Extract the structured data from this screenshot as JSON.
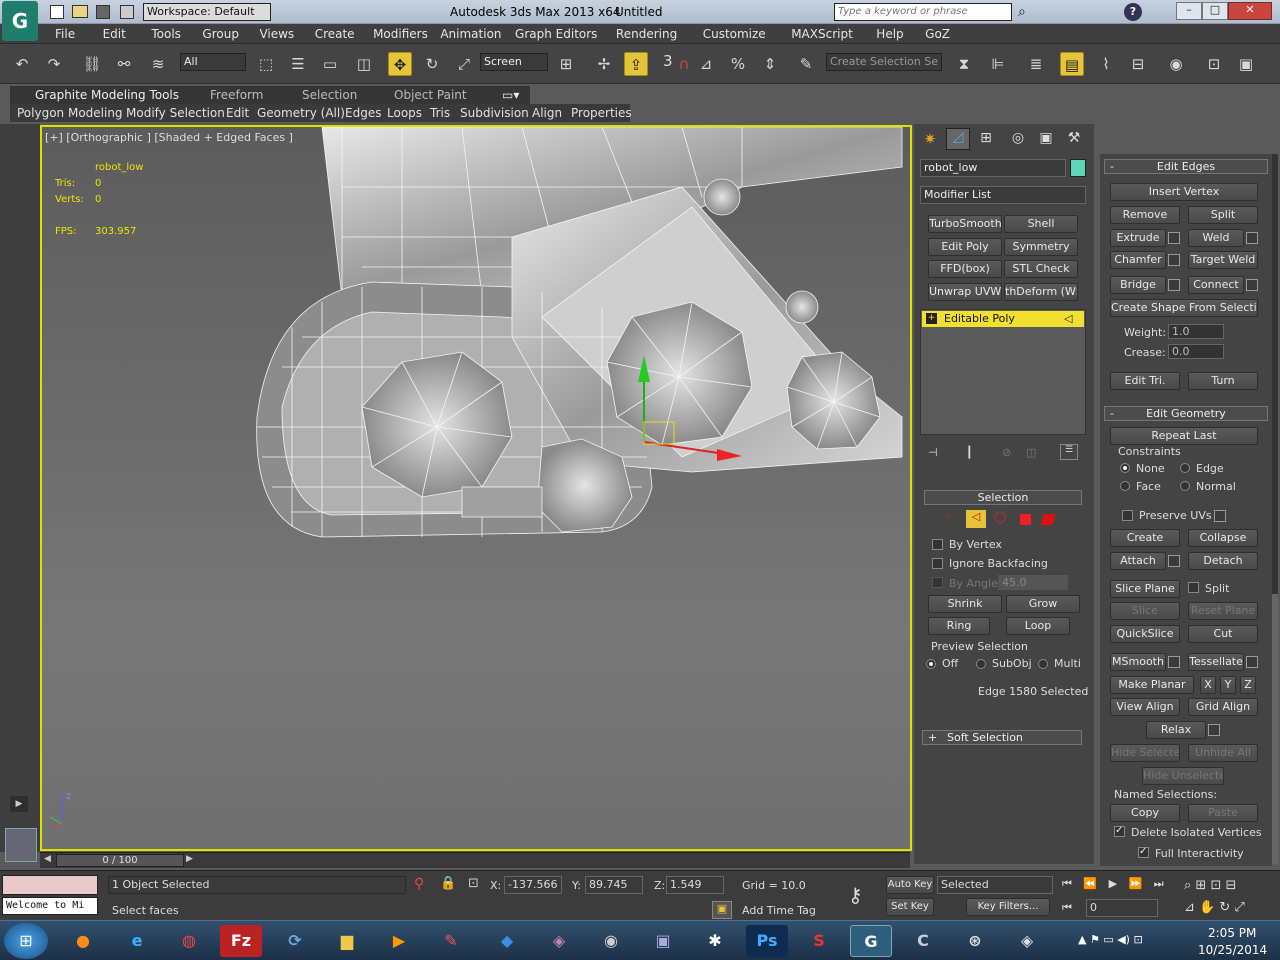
{
  "window": {
    "title": "Autodesk 3ds Max 2013 x64",
    "doc": "Untitled",
    "workspace": "Workspace: Default",
    "search_placeholder": "Type a keyword or phrase"
  },
  "menu": [
    "File",
    "Edit",
    "Tools",
    "Group",
    "Views",
    "Create",
    "Modifiers",
    "Animation",
    "Graph Editors",
    "Rendering",
    "Customize",
    "MAXScript",
    "Help",
    "GoZ"
  ],
  "toolbar": {
    "filter": "All",
    "coord": "Screen",
    "selset_placeholder": "Create Selection Se",
    "number": "3"
  },
  "ribbon": {
    "tabs": [
      "Graphite Modeling Tools",
      "Freeform",
      "Selection",
      "Object Paint"
    ],
    "panels": [
      "Polygon Modeling",
      "Modify Selection",
      "Edit",
      "Geometry (All)",
      "Edges",
      "Loops",
      "Tris",
      "Subdivision",
      "Align",
      "Properties"
    ]
  },
  "viewport": {
    "label": "[+] [Orthographic ] [Shaded + Edged Faces ]",
    "object": "robot_low",
    "tris_label": "Tris:",
    "tris": "0",
    "verts_label": "Verts:",
    "verts": "0",
    "fps_label": "FPS:",
    "fps": "303.957"
  },
  "modify": {
    "name": "robot_low",
    "modlist": "Modifier List",
    "mods": [
      "TurboSmooth",
      "Shell",
      "Edit Poly",
      "Symmetry",
      "FFD(box)",
      "STL Check",
      "Unwrap UVW",
      "thDeform (WSI"
    ],
    "stack_item": "Editable Poly"
  },
  "selection": {
    "title": "Selection",
    "by_vertex": "By Vertex",
    "ignore_backfacing": "Ignore Backfacing",
    "by_angle": "By Angle:",
    "angle": "45.0",
    "shrink": "Shrink",
    "grow": "Grow",
    "ring": "Ring",
    "loop": "Loop",
    "preview": "Preview Selection",
    "off": "Off",
    "subobj": "SubObj",
    "multi": "Multi",
    "status": "Edge 1580 Selected",
    "soft": "Soft Selection"
  },
  "edit_edges": {
    "title": "Edit Edges",
    "insert_vertex": "Insert Vertex",
    "remove": "Remove",
    "split": "Split",
    "extrude": "Extrude",
    "weld": "Weld",
    "chamfer": "Chamfer",
    "target_weld": "Target Weld",
    "bridge": "Bridge",
    "connect": "Connect",
    "create_shape": "Create Shape From Selection",
    "weight_label": "Weight:",
    "weight": "1.0",
    "crease_label": "Crease:",
    "crease": "0.0",
    "edit_tri": "Edit Tri.",
    "turn": "Turn"
  },
  "edit_geometry": {
    "title": "Edit Geometry",
    "repeat_last": "Repeat Last",
    "constraints": "Constraints",
    "none": "None",
    "edge": "Edge",
    "face": "Face",
    "normal": "Normal",
    "preserve_uvs": "Preserve UVs",
    "create": "Create",
    "collapse": "Collapse",
    "attach": "Attach",
    "detach": "Detach",
    "slice_plane": "Slice Plane",
    "split": "Split",
    "slice": "Slice",
    "reset_plane": "Reset Plane",
    "quickslice": "QuickSlice",
    "cut": "Cut",
    "msmooth": "MSmooth",
    "tessellate": "Tessellate",
    "make_planar": "Make Planar",
    "x": "X",
    "y": "Y",
    "z": "Z",
    "view_align": "View Align",
    "grid_align": "Grid Align",
    "relax": "Relax",
    "hide_selected": "Hide Selected",
    "unhide_all": "Unhide All",
    "hide_unselected": "Hide Unselected",
    "named_sel": "Named Selections:",
    "copy": "Copy",
    "paste": "Paste",
    "delete_isolated": "Delete Isolated Vertices",
    "full_interactivity": "Full Interactivity"
  },
  "status": {
    "selected": "1 Object Selected",
    "prompt": "Select faces",
    "listener": "Welcome to Mi",
    "x_label": "X:",
    "x": "-137.566",
    "y_label": "Y:",
    "y": "89.745",
    "z_label": "Z:",
    "z": "1.549",
    "grid": "Grid = 10.0",
    "auto_key": "Auto Key",
    "set_key": "Set Key",
    "key_mode": "Selected",
    "key_filters": "Key Filters...",
    "add_time_tag": "Add Time Tag",
    "frame": "0",
    "time": "0 / 100"
  },
  "taskbar": {
    "time": "2:05 PM",
    "date": "10/25/2014"
  },
  "colors": {
    "accent": "#e6c43a",
    "viewport_border": "#e0e000",
    "swatch": "#5fd4b8"
  }
}
